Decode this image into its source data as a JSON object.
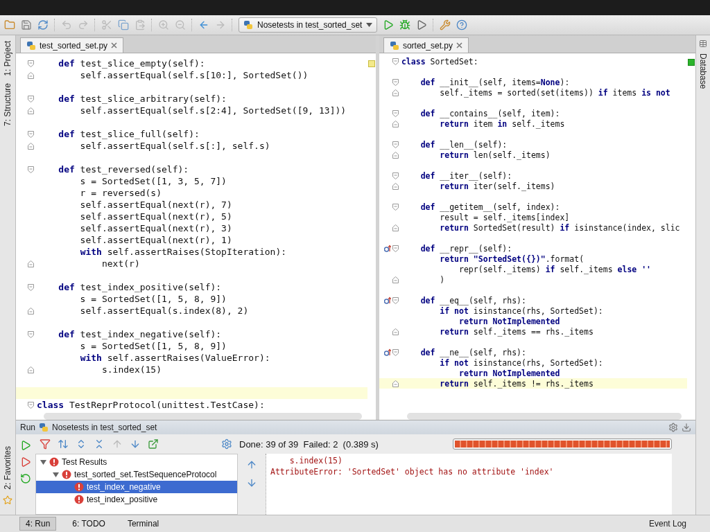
{
  "toolbar": {
    "run_config": "Nosetests in test_sorted_set"
  },
  "left_tool_strip": [
    {
      "label": "1: Project"
    },
    {
      "label": "7: Structure"
    }
  ],
  "editors": [
    {
      "tab": "test_sorted_set.py",
      "selected": true,
      "lines": [
        {
          "fold_start": true,
          "text": "    **def** test_slice_empty(self):"
        },
        {
          "fold_end": true,
          "text": "        self.assertEqual(self.s[10:], SortedSet())"
        },
        {
          "fold_start": true,
          "blank_before": true,
          "text": "    **def** test_slice_arbitrary(self):"
        },
        {
          "fold_end": true,
          "text": "        self.assertEqual(self.s[2:4], SortedSet([9, 13]))"
        },
        {
          "fold_start": true,
          "blank_before": true,
          "text": "    **def** test_slice_full(self):"
        },
        {
          "fold_end": true,
          "text": "        self.assertEqual(self.s[:], self.s)"
        },
        {
          "fold_start": true,
          "blank_before": true,
          "text": "    **def** test_reversed(self):"
        },
        {
          "text": "        s = SortedSet([1, 3, 5, 7])"
        },
        {
          "text": "        r = reversed(s)"
        },
        {
          "text": "        self.assertEqual(next(r), 7)"
        },
        {
          "text": "        self.assertEqual(next(r), 5)"
        },
        {
          "text": "        self.assertEqual(next(r), 3)"
        },
        {
          "text": "        self.assertEqual(next(r), 1)"
        },
        {
          "text": "        **with** self.assertRaises(StopIteration):"
        },
        {
          "fold_end": true,
          "text": "            next(r)"
        },
        {
          "fold_start": true,
          "blank_before": true,
          "text": "    **def** test_index_positive(self):"
        },
        {
          "text": "        s = SortedSet([1, 5, 8, 9])"
        },
        {
          "fold_end": true,
          "text": "        self.assertEqual(s.index(8), 2)"
        },
        {
          "fold_start": true,
          "blank_before": true,
          "text": "    **def** test_index_negative(self):"
        },
        {
          "text": "        s = SortedSet([1, 5, 8, 9])"
        },
        {
          "text": "        **with** self.assertRaises(ValueError):"
        },
        {
          "fold_end": true,
          "text": "            s.index(15)"
        },
        {
          "fold_start": true,
          "blank_before": true,
          "current_blank_before": true,
          "text": "**class** TestReprProtocol(unittest.TestCase):"
        }
      ]
    },
    {
      "tab": "sorted_set.py",
      "selected": true,
      "lines": [
        {
          "fold_start": true,
          "text": "**class** SortedSet:"
        },
        {
          "fold_start": true,
          "blank_before": true,
          "text": "    **def** __init__(self, items=**None**):"
        },
        {
          "fold_end": true,
          "text": "        self._items = sorted(set(items)) **if** items **is not**"
        },
        {
          "fold_start": true,
          "blank_before": true,
          "text": "    **def** __contains__(self, item):"
        },
        {
          "fold_end": true,
          "text": "        **return** item **in** self._items"
        },
        {
          "fold_start": true,
          "blank_before": true,
          "text": "    **def** __len__(self):"
        },
        {
          "fold_end": true,
          "text": "        **return** len(self._items)"
        },
        {
          "fold_start": true,
          "blank_before": true,
          "text": "    **def** __iter__(self):"
        },
        {
          "fold_end": true,
          "text": "        **return** iter(self._items)"
        },
        {
          "fold_start": true,
          "blank_before": true,
          "text": "    **def** __getitem__(self, index):"
        },
        {
          "text": "        result = self._items[index]"
        },
        {
          "fold_end": true,
          "text": "        **return** SortedSet(result) **if** isinstance(index, slic"
        },
        {
          "fold_start": true,
          "blank_before": true,
          "override": true,
          "text": "    **def** __repr__(self):"
        },
        {
          "text": "        **return** **\"SortedSet({})\"**.format("
        },
        {
          "text": "            repr(self._items) **if** self._items **else** **''**"
        },
        {
          "fold_end": true,
          "text": "        )"
        },
        {
          "fold_start": true,
          "blank_before": true,
          "override": true,
          "text": "    **def** __eq__(self, rhs):"
        },
        {
          "text": "        **if not** isinstance(rhs, SortedSet):"
        },
        {
          "text": "            **return** **NotImplemented**"
        },
        {
          "fold_end": true,
          "text": "        **return** self._items == rhs._items"
        },
        {
          "fold_start": true,
          "blank_before": true,
          "override": true,
          "text": "    **def** __ne__(self, rhs):"
        },
        {
          "text": "        **if not** isinstance(rhs, SortedSet):"
        },
        {
          "text": "            **return** **NotImplemented**"
        },
        {
          "fold_end": true,
          "current": true,
          "text": "        **return** self._items != rhs._items"
        }
      ]
    }
  ],
  "right_tool_strip": [
    {
      "label": "Database"
    }
  ],
  "run_panel": {
    "title": "Run",
    "config": "Nosetests in test_sorted_set",
    "status": {
      "done": "Done: 39 of 39",
      "failed": "Failed: 2",
      "time": "(0.389 s)"
    },
    "progress": {
      "level": 1
    },
    "tree": [
      {
        "label": "Test Results",
        "expanded": true,
        "selected": false,
        "children": [
          {
            "label": "test_sorted_set.TestSequenceProtocol",
            "expanded": true,
            "selected": false,
            "children": [
              {
                "label": "test_index_negative",
                "selected": true
              },
              {
                "label": "test_index_positive",
                "selected": false
              }
            ]
          }
        ]
      }
    ],
    "console": [
      {
        "text": "    s.index(15)"
      },
      {
        "text": "AttributeError: 'SortedSet' object has no attribute 'index'"
      }
    ]
  },
  "favorites_strip": [
    {
      "label": "2: Favorites"
    }
  ],
  "bottom_bar": {
    "tabs": [
      {
        "label": "4: Run",
        "selected": true
      },
      {
        "label": "6: TODO",
        "selected": false
      },
      {
        "label": "Terminal",
        "selected": false
      }
    ],
    "event_log": "Event Log"
  }
}
